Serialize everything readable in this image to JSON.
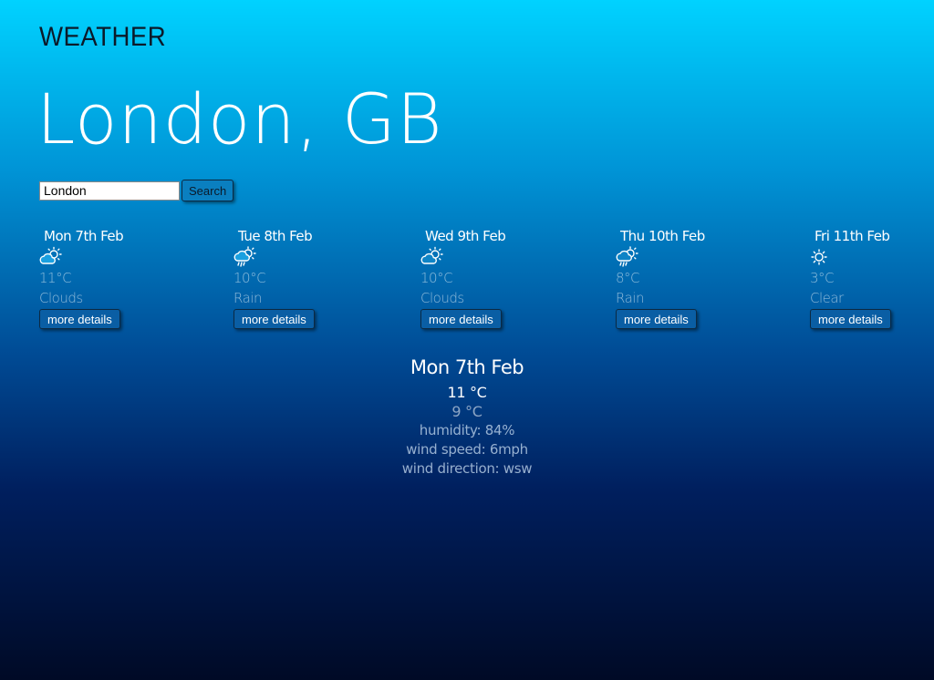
{
  "header": {
    "title": "WEATHER",
    "location": "London, GB"
  },
  "search": {
    "value": "London",
    "button_label": "Search"
  },
  "forecast": [
    {
      "day": "Mon 7th Feb",
      "icon": "cloud-sun-icon",
      "temp": "11°C",
      "desc": "Clouds",
      "button": "more details"
    },
    {
      "day": "Tue 8th Feb",
      "icon": "rain-sun-icon",
      "temp": "10°C",
      "desc": "Rain",
      "button": "more details"
    },
    {
      "day": "Wed 9th Feb",
      "icon": "cloud-sun-icon",
      "temp": "10°C",
      "desc": "Clouds",
      "button": "more details"
    },
    {
      "day": "Thu 10th Feb",
      "icon": "rain-sun-icon",
      "temp": "8°C",
      "desc": "Rain",
      "button": "more details"
    },
    {
      "day": "Fri 11th Feb",
      "icon": "sun-icon",
      "temp": "3°C",
      "desc": "Clear",
      "button": "more details"
    }
  ],
  "details": {
    "day": "Mon 7th Feb",
    "high": "11 °C",
    "low": "9 °C",
    "humidity": "humidity: 84%",
    "wind_speed": "wind speed: 6mph",
    "wind_direction": "wind direction: wsw"
  }
}
